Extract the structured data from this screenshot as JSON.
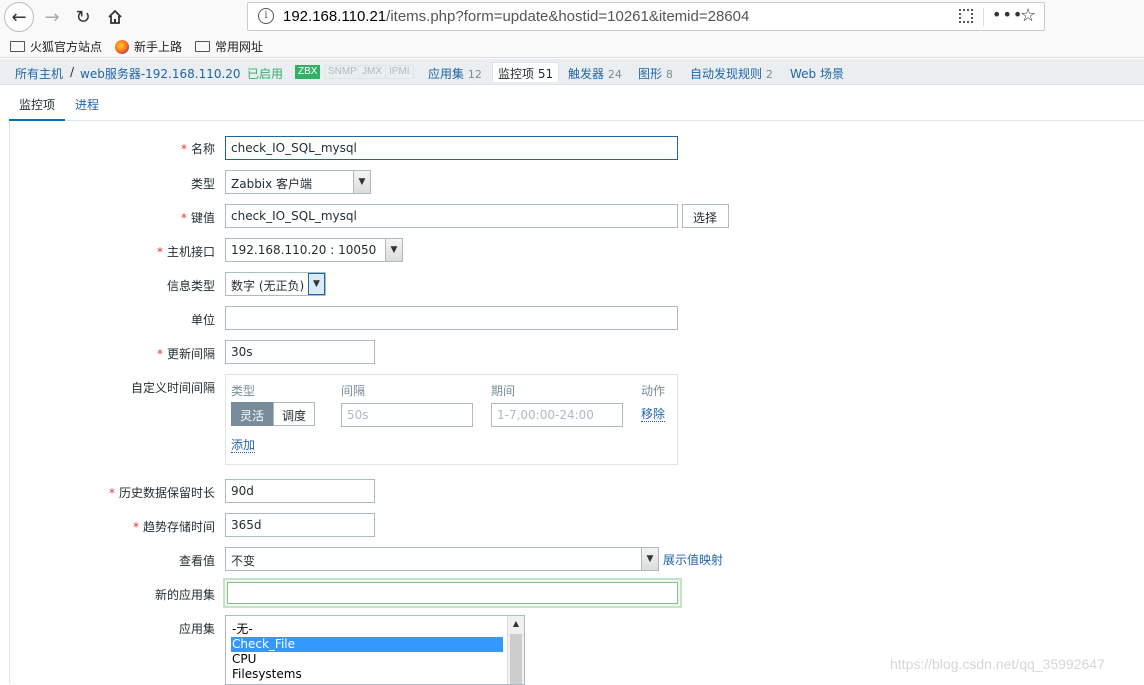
{
  "browser": {
    "url_host": "192.168.110.21",
    "url_path": "/items.php?form=update&hostid=10261&itemid=28604",
    "bookmarks": [
      "火狐官方站点",
      "新手上路",
      "常用网址"
    ]
  },
  "hostnav": {
    "all_hosts": "所有主机",
    "separator": "/",
    "host": "web服务器-192.168.110.20",
    "status": "已启用",
    "tags": [
      "ZBX",
      "SNMP",
      "JMX",
      "IPMI"
    ],
    "applications": {
      "label": "应用集",
      "count": "12"
    },
    "items": {
      "label": "监控项",
      "count": "51"
    },
    "triggers": {
      "label": "触发器",
      "count": "24"
    },
    "graphs": {
      "label": "图形",
      "count": "8"
    },
    "discovery": {
      "label": "自动发现规则",
      "count": "2"
    },
    "web": {
      "label": "Web 场景"
    }
  },
  "tabs": [
    "监控项",
    "进程"
  ],
  "form": {
    "name_label": "名称",
    "name_value": "check_IO_SQL_mysql",
    "type_label": "类型",
    "type_value": "Zabbix 客户端",
    "key_label": "键值",
    "key_value": "check_IO_SQL_mysql",
    "key_select_button": "选择",
    "interface_label": "主机接口",
    "interface_value": "192.168.110.20 : 10050",
    "info_type_label": "信息类型",
    "info_type_value": "数字 (无正负)",
    "units_label": "单位",
    "units_value": "",
    "interval_label": "更新间隔",
    "interval_value": "30s",
    "custom_label": "自定义时间间隔",
    "custom": {
      "col_type": "类型",
      "col_interval": "间隔",
      "col_period": "期间",
      "col_action": "动作",
      "flexible": "灵活",
      "scheduling": "调度",
      "interval_placeholder": "50s",
      "period_placeholder": "1-7,00:00-24:00",
      "remove": "移除",
      "add": "添加"
    },
    "history_label": "历史数据保留时长",
    "history_value": "90d",
    "trends_label": "趋势存储时间",
    "trends_value": "365d",
    "valuemap_label": "查看值",
    "valuemap_value": "不变",
    "valuemap_link": "展示值映射",
    "new_app_label": "新的应用集",
    "new_app_value": "",
    "apps_label": "应用集",
    "apps_options": [
      "-无-",
      "Check_File",
      "CPU",
      "Filesystems"
    ],
    "apps_selected": "Check_File"
  },
  "watermark": "https://blog.csdn.net/qq_35992647"
}
